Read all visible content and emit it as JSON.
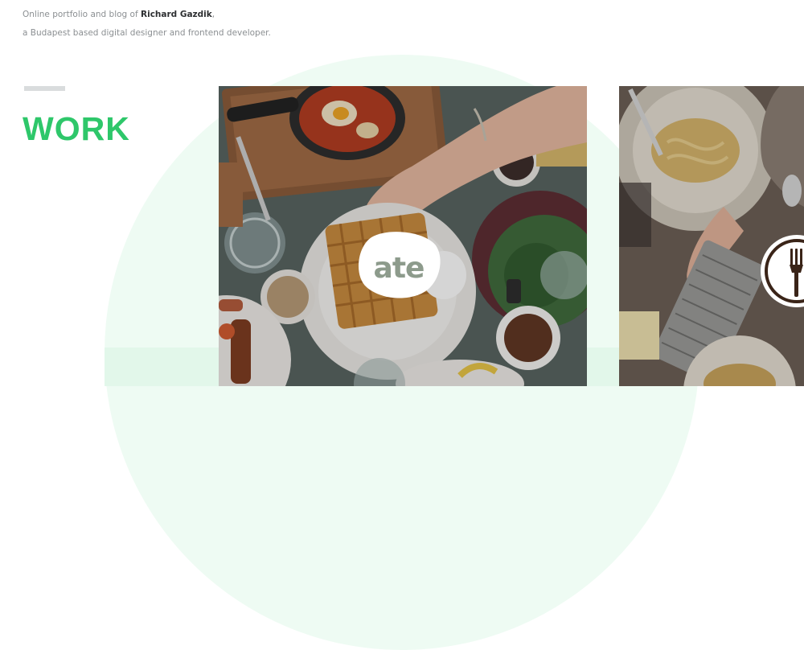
{
  "intro": {
    "line1_prefix": "Online portfolio and blog of ",
    "author": "Richard Gazdik",
    "line1_suffix": ",",
    "line2": "a Budapest based digital designer and frontend developer."
  },
  "section": {
    "title": "WORK",
    "accent_color": "#2ec76a"
  },
  "projects": [
    {
      "logo_text": "ate",
      "icon": "ate-logo-icon"
    },
    {
      "logo_text": "",
      "icon": "fork-icon"
    }
  ]
}
